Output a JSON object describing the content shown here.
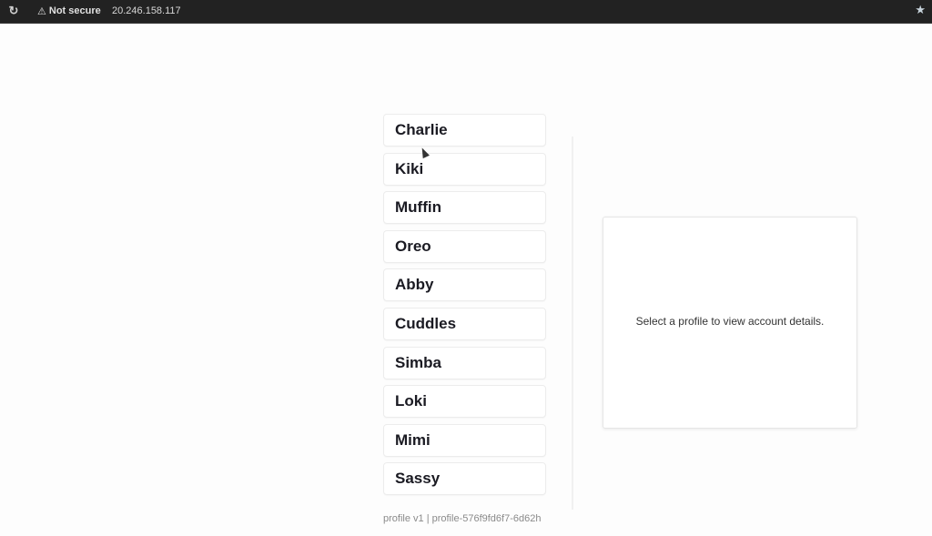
{
  "browser": {
    "reload_icon": "reload-icon",
    "security_label": "Not secure",
    "security_icon": "warning-triangle-icon",
    "url": "20.246.158.117",
    "bookmark_icon": "star-icon"
  },
  "profiles": [
    {
      "name": "Charlie"
    },
    {
      "name": "Kiki"
    },
    {
      "name": "Muffin"
    },
    {
      "name": "Oreo"
    },
    {
      "name": "Abby"
    },
    {
      "name": "Cuddles"
    },
    {
      "name": "Simba"
    },
    {
      "name": "Loki"
    },
    {
      "name": "Mimi"
    },
    {
      "name": "Sassy"
    }
  ],
  "details": {
    "placeholder": "Select a profile to view account details."
  },
  "footer": {
    "text": "profile v1 | profile-576f9fd6f7-6d62h"
  }
}
